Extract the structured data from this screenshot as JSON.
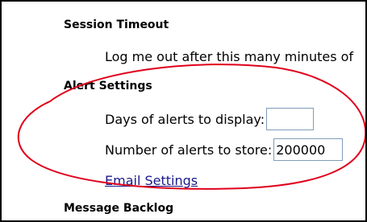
{
  "session_timeout": {
    "heading": "Session Timeout",
    "label": "Log me out after this many minutes of"
  },
  "alert_settings": {
    "heading": "Alert Settings",
    "days_label": "Days of alerts to display:",
    "days_value": "",
    "store_label": "Number of alerts to store:",
    "store_value": "200000"
  },
  "email_settings_link": "Email Settings",
  "message_backlog": {
    "heading": "Message Backlog"
  },
  "colors": {
    "annotation": "#e0001b",
    "link": "#1a1a8c",
    "field_border": "#7f9db9"
  }
}
